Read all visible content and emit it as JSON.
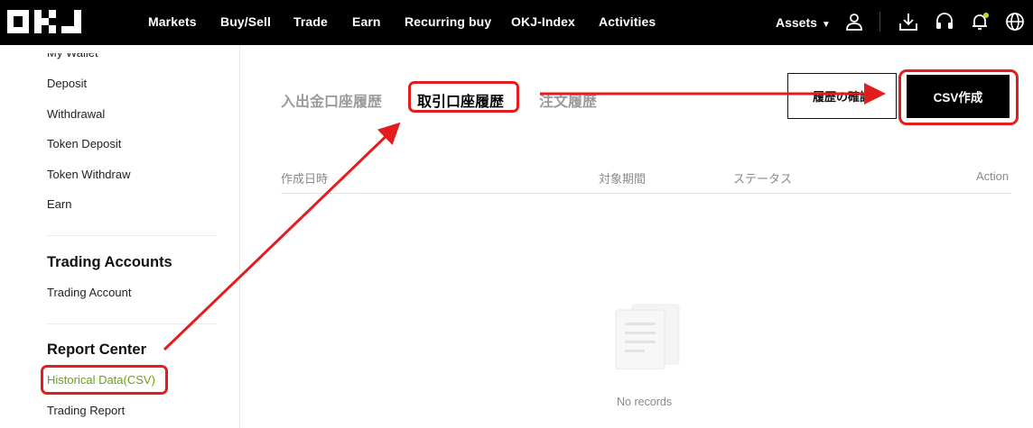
{
  "nav": {
    "logo": "OKJ",
    "items": [
      "Markets",
      "Buy/Sell",
      "Trade",
      "Earn",
      "Recurring buy",
      "OKJ-Index",
      "Activities"
    ],
    "assets_label": "Assets"
  },
  "sidebar": {
    "wallet_links": [
      "My Wallet",
      "Deposit",
      "Withdrawal",
      "Token Deposit",
      "Token Withdraw",
      "Earn"
    ],
    "trading_heading": "Trading Accounts",
    "trading_link": "Trading Account",
    "report_heading": "Report Center",
    "historical_link": "Historical Data(CSV)",
    "trading_report_link": "Trading Report"
  },
  "tabs": [
    "入出金口座履歴",
    "取引口座履歴",
    "注文履歴"
  ],
  "buttons": {
    "check_history": "履歴の確認",
    "create_csv": "CSV作成"
  },
  "table": {
    "headers": [
      "作成日時",
      "対象期間",
      "ステータス",
      "Action"
    ],
    "empty_text": "No records"
  },
  "colors": {
    "active_link": "#6aa01c",
    "annotation": "#e31d1d"
  }
}
